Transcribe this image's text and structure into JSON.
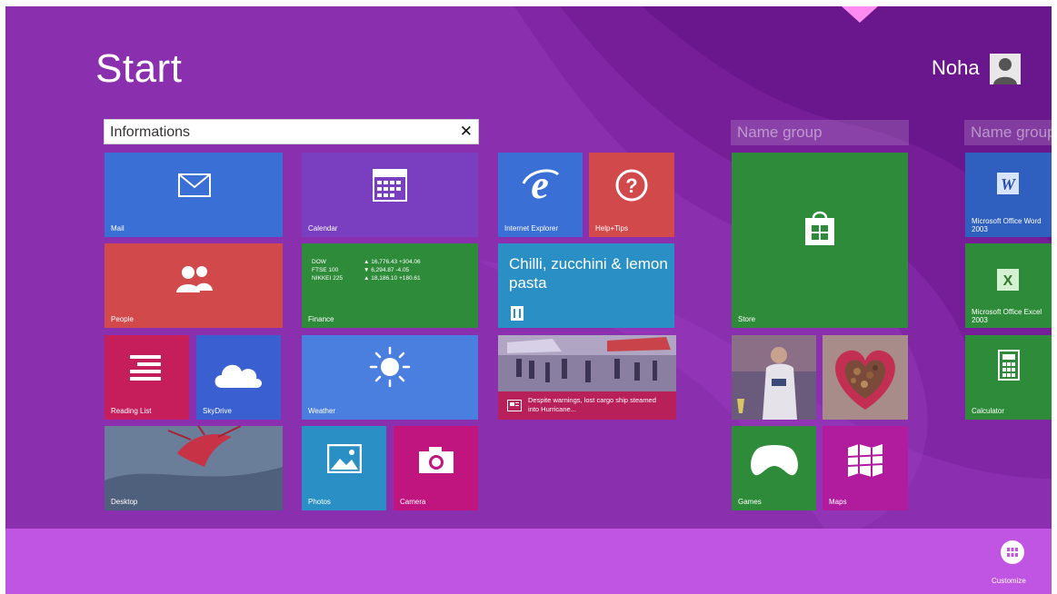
{
  "header": {
    "title": "Start",
    "user_name": "Noha"
  },
  "search": {
    "value": "Informations",
    "clear_icon": "close-icon"
  },
  "groups": {
    "group2_name": "Name group",
    "group3_name": "Name group"
  },
  "tiles": {
    "mail": "Mail",
    "calendar": "Calendar",
    "internet_explorer": "Internet Explorer",
    "help_tips": "Help+Tips",
    "people": "People",
    "finance": "Finance",
    "reading_list": "Reading List",
    "skydrive": "SkyDrive",
    "weather": "Weather",
    "desktop": "Desktop",
    "photos": "Photos",
    "camera": "Camera",
    "store": "Store",
    "games": "Games",
    "maps": "Maps",
    "word": "Microsoft Office Word 2003",
    "excel": "Microsoft Office Excel 2003",
    "calculator": "Calculator"
  },
  "finance": {
    "rows": [
      {
        "index": "DOW",
        "arrow": "▲",
        "value": "16,776.43 +304.06"
      },
      {
        "index": "FTSE 100",
        "arrow": "▼",
        "value": "6,294.87 -4.05"
      },
      {
        "index": "NIKKEI 225",
        "arrow": "▲",
        "value": "18,186.10 +180.61"
      }
    ]
  },
  "food": {
    "title": "Chilli, zucchini & lemon pasta"
  },
  "news": {
    "headline": "Despite warnings, lost cargo ship steamed into Hurricane..."
  },
  "appbar": {
    "customize_label": "Customize"
  },
  "colors": {
    "background": "#8a2fae",
    "appbar": "#bf55e2",
    "blue_tile": "#3a6fd6",
    "red_tile": "#d2494c",
    "green_tile": "#2e8b3a",
    "purple_tile": "#7a3fc0",
    "teal_tile": "#2a8fc4",
    "pink_tile": "#c0147e",
    "crimson_tile": "#c51e5a"
  }
}
